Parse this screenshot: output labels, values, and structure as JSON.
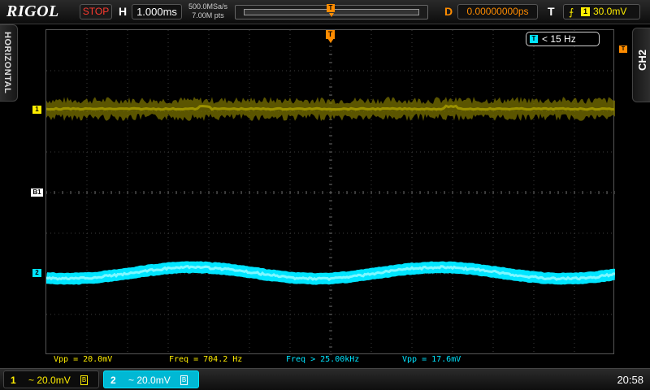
{
  "header": {
    "brand": "RIGOL",
    "status": "STOP",
    "horizontal_label": "H",
    "timebase": "1.000ms",
    "sample_rate": "500.0MSa/s",
    "memory_depth": "7.00M pts",
    "trigger_marker": "T",
    "delay_label": "D",
    "delay_value": "0.00000000ps",
    "trigger_label": "T",
    "trigger_source": "1",
    "trigger_level": "30.0mV"
  },
  "side": {
    "left_label": "HORIZONTAL",
    "right_label": "CH2"
  },
  "screen": {
    "freq_counter_icon": "T",
    "freq_counter_text": "< 15 Hz",
    "trigger_position_marker": "T",
    "ch1_marker": "1",
    "ch2_marker": "2",
    "b1_marker": "B1"
  },
  "measurements": [
    {
      "text": "Vpp = 20.0mV",
      "color": "#ffee00"
    },
    {
      "text": "Freq = 704.2 Hz",
      "color": "#ffee00"
    },
    {
      "text": "Freq > 25.00kHz",
      "color": "#00e5ff"
    },
    {
      "text": "Vpp = 17.6mV",
      "color": "#00e5ff"
    }
  ],
  "footer": {
    "ch1": {
      "num": "1",
      "scale": "~ 20.0mV",
      "bw": "B"
    },
    "ch2": {
      "num": "2",
      "scale": "~ 20.0mV",
      "bw": "B"
    },
    "clock": "20:58"
  },
  "colors": {
    "ch1": "#ffee00",
    "ch2": "#00e5ff",
    "trigger": "#ff8c00",
    "status_stop": "#ff3b30"
  }
}
